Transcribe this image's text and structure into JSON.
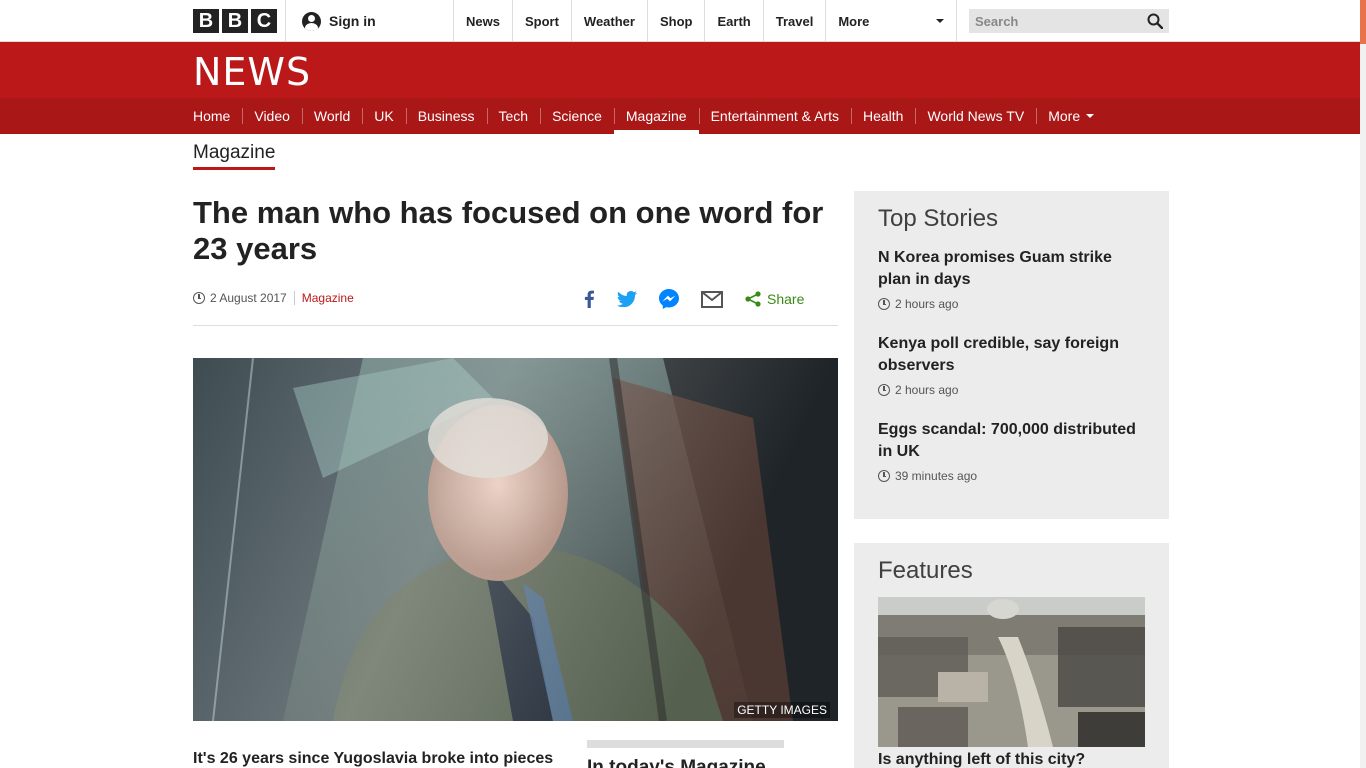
{
  "top_bar": {
    "logo_letters": [
      "B",
      "B",
      "C"
    ],
    "signin_label": "Sign in",
    "nav": [
      "News",
      "Sport",
      "Weather",
      "Shop",
      "Earth",
      "Travel"
    ],
    "more_label": "More",
    "search_placeholder": "Search"
  },
  "news_band": {
    "logo": "NEWS"
  },
  "section_nav": {
    "items": [
      "Home",
      "Video",
      "World",
      "UK",
      "Business",
      "Tech",
      "Science",
      "Magazine",
      "Entertainment & Arts",
      "Health",
      "World News TV",
      "More"
    ],
    "active": "Magazine"
  },
  "section_title": "Magazine",
  "article": {
    "headline": "The man who has focused on one word for 23 years",
    "date": "2 August 2017",
    "category": "Magazine",
    "share_label": "Share",
    "image_credit": "GETTY IMAGES",
    "intro": "It's 26 years since Yugoslavia broke into pieces"
  },
  "in_todays_magazine": "In today's Magazine",
  "top_stories": {
    "heading": "Top Stories",
    "items": [
      {
        "title": "N Korea promises Guam strike plan in days",
        "time": "2 hours ago"
      },
      {
        "title": "Kenya poll credible, say foreign observers",
        "time": "2 hours ago"
      },
      {
        "title": "Eggs scandal: 700,000 distributed in UK",
        "time": "39 minutes ago"
      }
    ]
  },
  "features": {
    "heading": "Features",
    "first_title": "Is anything left of this city?"
  },
  "colors": {
    "brand_red": "#bb1919",
    "nav_red": "#a91717",
    "share_green": "#3a8a16",
    "facebook_blue": "#3b5998",
    "twitter_blue": "#1da1f2",
    "messenger_blue": "#0084ff"
  },
  "icons": [
    "user-icon",
    "search-icon",
    "clock-icon",
    "facebook-icon",
    "twitter-icon",
    "messenger-icon",
    "email-icon",
    "share-icon",
    "caret-down-icon"
  ]
}
